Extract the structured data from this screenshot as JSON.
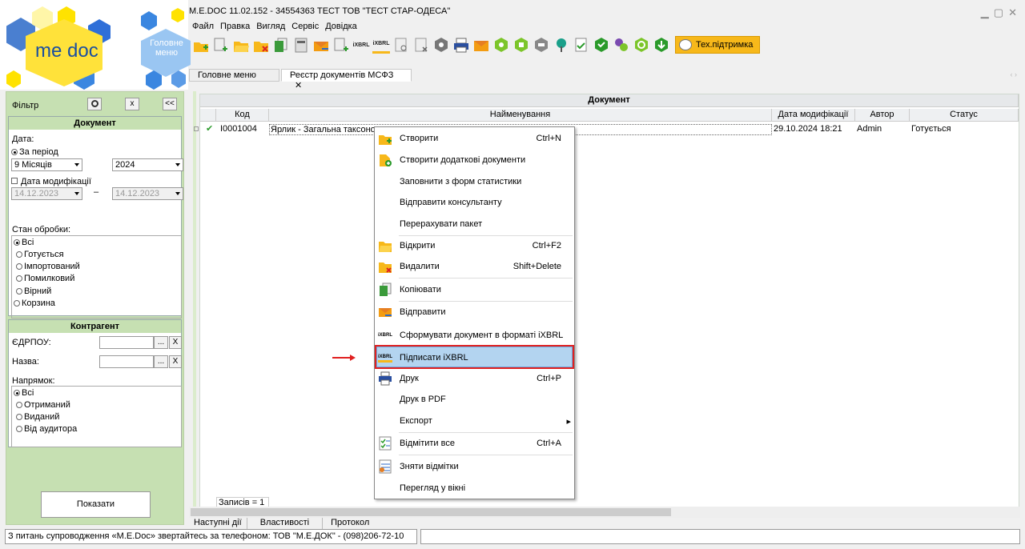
{
  "window": {
    "title": "M.E.DOC 11.02.152  - 34554363 ТЕСТ ТОВ \"ТЕСТ СТАР-ОДЕСА\""
  },
  "logo": {
    "text": "me doc",
    "home": "Головне меню"
  },
  "menu": [
    "Файл",
    "Правка",
    "Вигляд",
    "Сервіс",
    "Довідка"
  ],
  "toolbar": {
    "ixbrl1": "iXBRL",
    "ixbrl2": "iXBRL",
    "support": "Тех.підтримка"
  },
  "tabs": [
    {
      "label": "Головне меню"
    },
    {
      "label": "Реєстр документів МСФЗ",
      "close": "✕"
    }
  ],
  "filter": {
    "title": "Фільтр",
    "btn_x": "x",
    "btn_collapse": "<<",
    "doc_header": "Документ",
    "date_label": "Дата:",
    "period_label": "За період",
    "period_value": "9 Місяців",
    "year_value": "2024",
    "mod_date_label": "Дата модифікації",
    "date_from": "14.12.2023",
    "date_to": "14.12.2023",
    "dash": "–",
    "state_label": "Стан обробки:",
    "states": [
      "Всі",
      "Готується",
      "Імпортований",
      "Помилковий",
      "Вірний",
      "Корзина"
    ],
    "contragent_header": "Контрагент",
    "edrpou_label": "ЄДРПОУ:",
    "name_label": "Назва:",
    "dots": "...",
    "clear": "X",
    "direction_label": "Напрямок:",
    "directions": [
      "Всі",
      "Отриманий",
      "Виданий",
      "Від аудитора"
    ],
    "show_button": "Показати"
  },
  "grid": {
    "group_header": "Документ",
    "columns": [
      "Код",
      "Найменування",
      "Дата модифікації",
      "Автор",
      "Статус"
    ],
    "row": {
      "check": "✔",
      "code": "I0001004",
      "name": "Ярлик - Загальна таксоно",
      "date": "29.10.2024 18:21",
      "author": "Admin",
      "status": "Готується"
    },
    "records": "Записів = 1"
  },
  "context_menu": [
    {
      "label": "Створити",
      "shortcut": "Ctrl+N",
      "icon": "folder-new-icon"
    },
    {
      "label": "Створити додаткові документи",
      "shortcut": "",
      "icon": "folder-add-icon"
    },
    {
      "label": "Заповнити з форм статистики",
      "shortcut": "",
      "icon": ""
    },
    {
      "label": "Відправити консультанту",
      "shortcut": "",
      "icon": ""
    },
    {
      "label": "Перерахувати пакет",
      "shortcut": "",
      "icon": ""
    },
    {
      "label": "Відкрити",
      "shortcut": "Ctrl+F2",
      "icon": "folder-open-icon"
    },
    {
      "label": "Видалити",
      "shortcut": "Shift+Delete",
      "icon": "folder-delete-icon"
    },
    {
      "label": "Копіювати",
      "shortcut": "",
      "icon": "copy-icon"
    },
    {
      "label": "Відправити",
      "shortcut": "",
      "icon": "send-icon"
    },
    {
      "label": "Сформувати документ в форматі iXBRL",
      "shortcut": "",
      "icon": "ixbrl-generate-icon"
    },
    {
      "label": "Підписати iXBRL",
      "shortcut": "",
      "icon": "ixbrl-sign-icon"
    },
    {
      "label": "Друк",
      "shortcut": "Ctrl+P",
      "icon": "printer-icon"
    },
    {
      "label": "Друк в PDF",
      "shortcut": "",
      "icon": ""
    },
    {
      "label": "Експорт",
      "shortcut": "",
      "icon": ""
    },
    {
      "label": "Відмітити все",
      "shortcut": "Ctrl+A",
      "icon": "check-all-icon"
    },
    {
      "label": "Зняти відмітки",
      "shortcut": "",
      "icon": "uncheck-icon"
    },
    {
      "label": "Перегляд у вікні",
      "shortcut": "",
      "icon": ""
    }
  ],
  "context_icons_text": {
    "ixbrl": "iXBRL",
    "submenu_arrow": "▸"
  },
  "bottom_tabs": [
    "Наступні дії",
    "Властивості",
    "Протокол"
  ],
  "status": {
    "text": "З питань супроводження «M.E.Doc» звертайтесь за телефоном: ТОВ \"М.Е.ДОК\" - (098)206-72-10"
  },
  "colors": {
    "accent": "#f7b81a",
    "highlight": "#b3d4f0",
    "filter_bg": "#c6e0b2",
    "arrow": "#e02020"
  }
}
